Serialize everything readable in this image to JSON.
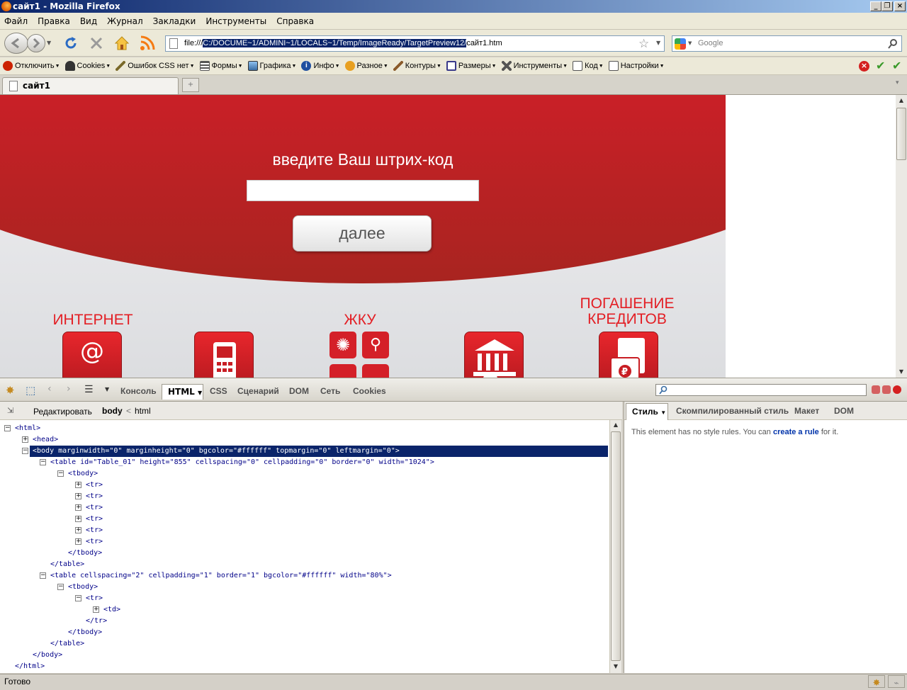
{
  "window": {
    "title": "сайт1 - Mozilla Firefox"
  },
  "menu": [
    "Файл",
    "Правка",
    "Вид",
    "Журнал",
    "Закладки",
    "Инструменты",
    "Справка"
  ],
  "nav": {
    "url_prefix": "file:///",
    "url_selected": "C:/DOCUME~1/ADMINI~1/LOCALS~1/Temp/ImageReady/TargetPreview12/",
    "url_suffix": "сайт1.htm",
    "search_placeholder": "Google"
  },
  "webdev_toolbar": [
    {
      "label": "Отключить",
      "icon": "disable-icon",
      "color": "#cc2200"
    },
    {
      "label": "Cookies",
      "icon": "cookies-icon",
      "color": "#333333"
    },
    {
      "label": "Ошибок CSS нет",
      "icon": "css-pencil-icon",
      "color": "#7a6a2a"
    },
    {
      "label": "Формы",
      "icon": "forms-icon",
      "color": "#555555"
    },
    {
      "label": "Графика",
      "icon": "images-icon",
      "color": "#3a6ea5"
    },
    {
      "label": "Инфо",
      "icon": "info-icon",
      "color": "#1f4fa0"
    },
    {
      "label": "Разное",
      "icon": "misc-icon",
      "color": "#b36b00"
    },
    {
      "label": "Контуры",
      "icon": "outline-icon",
      "color": "#8a5a2a"
    },
    {
      "label": "Размеры",
      "icon": "resize-icon",
      "color": "#3a3a8a"
    },
    {
      "label": "Инструменты",
      "icon": "tools-icon",
      "color": "#555555"
    },
    {
      "label": "Код",
      "icon": "source-icon",
      "color": "#555555"
    },
    {
      "label": "Настройки",
      "icon": "settings-icon",
      "color": "#555555"
    }
  ],
  "tab": {
    "label": "сайт1"
  },
  "site": {
    "prompt": "введите Ваш штрих-код",
    "next_button": "далее",
    "categories": [
      {
        "label": "ИНТЕРНЕТ",
        "glyph": "@"
      },
      {
        "label": "",
        "glyph": "▯"
      },
      {
        "label": "ЖКУ",
        "glyph": "✺"
      },
      {
        "label": "",
        "glyph": "🏛"
      },
      {
        "label": "ПОГАШЕНИЕ КРЕДИТОВ",
        "glyph": "₽"
      }
    ]
  },
  "devtools": {
    "tabs": [
      "Консоль",
      "HTML",
      "CSS",
      "Сценарий",
      "DOM",
      "Сеть",
      "Cookies"
    ],
    "edit_label": "Редактировать",
    "breadcrumb": [
      "body",
      "<",
      "html"
    ],
    "right_tabs": [
      "Стиль",
      "Скомпилированный стиль",
      "Макет",
      "DOM"
    ],
    "style_msg_prefix": "This element has no style rules. You can ",
    "style_msg_link": "create a rule",
    "style_msg_suffix": " for it.",
    "tree": [
      {
        "indent": 0,
        "toggle": "−",
        "text": "<html>"
      },
      {
        "indent": 1,
        "toggle": "+",
        "text": "<head>"
      },
      {
        "indent": 1,
        "toggle": "−",
        "text": "<body marginwidth=\"0\" marginheight=\"0\" bgcolor=\"#ffffff\" topmargin=\"0\" leftmargin=\"0\">",
        "selected": true
      },
      {
        "indent": 2,
        "toggle": "−",
        "text": "<table id=\"Table_01\" height=\"855\" cellspacing=\"0\" cellpadding=\"0\" border=\"0\" width=\"1024\">"
      },
      {
        "indent": 3,
        "toggle": "−",
        "text": "<tbody>"
      },
      {
        "indent": 4,
        "toggle": "+",
        "text": "<tr>"
      },
      {
        "indent": 4,
        "toggle": "+",
        "text": "<tr>"
      },
      {
        "indent": 4,
        "toggle": "+",
        "text": "<tr>"
      },
      {
        "indent": 4,
        "toggle": "+",
        "text": "<tr>"
      },
      {
        "indent": 4,
        "toggle": "+",
        "text": "<tr>"
      },
      {
        "indent": 4,
        "toggle": "+",
        "text": "<tr>"
      },
      {
        "indent": 3,
        "toggle": "",
        "text": "</tbody>"
      },
      {
        "indent": 2,
        "toggle": "",
        "text": "</table>"
      },
      {
        "indent": 2,
        "toggle": "−",
        "text": "<table cellspacing=\"2\" cellpadding=\"1\" border=\"1\" bgcolor=\"#ffffff\" width=\"80%\">"
      },
      {
        "indent": 3,
        "toggle": "−",
        "text": "<tbody>"
      },
      {
        "indent": 4,
        "toggle": "−",
        "text": "<tr>"
      },
      {
        "indent": 5,
        "toggle": "+",
        "text": "<td>"
      },
      {
        "indent": 4,
        "toggle": "",
        "text": "</tr>"
      },
      {
        "indent": 3,
        "toggle": "",
        "text": "</tbody>"
      },
      {
        "indent": 2,
        "toggle": "",
        "text": "</table>"
      },
      {
        "indent": 1,
        "toggle": "",
        "text": "</body>"
      },
      {
        "indent": 0,
        "toggle": "",
        "text": "</html>"
      }
    ]
  },
  "status": {
    "text": "Готово"
  }
}
